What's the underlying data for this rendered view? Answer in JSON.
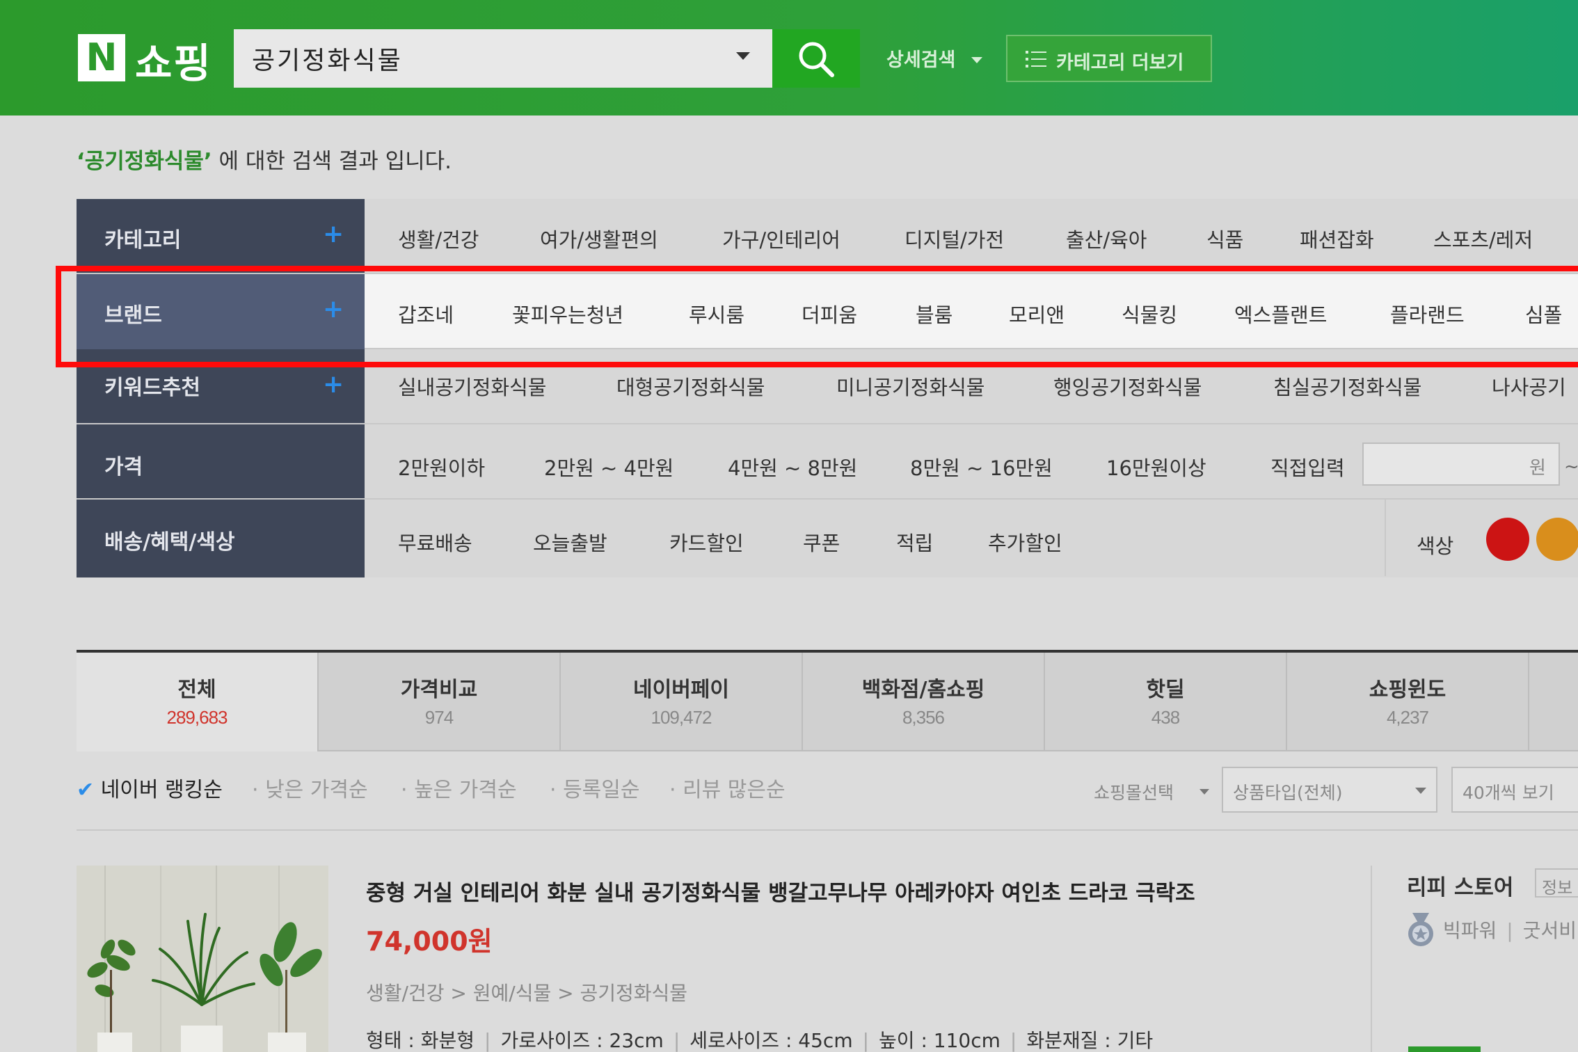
{
  "header": {
    "logo_letter": "N",
    "logo_text": "쇼핑",
    "search_value": "공기정화식물",
    "advanced_search": "상세검색",
    "category_more": "카테고리 더보기"
  },
  "result_line": {
    "keyword": "‘공기정화식물’",
    "suffix": " 에 대한 검색 결과 입니다."
  },
  "filters": {
    "category": {
      "label": "카테고리",
      "plus": "+",
      "items": [
        "생활/건강",
        "여가/생활편의",
        "가구/인테리어",
        "디지털/가전",
        "출산/육아",
        "식품",
        "패션잡화",
        "스포츠/레저"
      ]
    },
    "brand": {
      "label": "브랜드",
      "plus": "+",
      "items": [
        "갑조네",
        "꽃피우는청년",
        "루시룸",
        "더피움",
        "블룸",
        "모리앤",
        "식물킹",
        "엑스플랜트",
        "플라랜드",
        "심폴"
      ]
    },
    "keyword": {
      "label": "키워드추천",
      "plus": "+",
      "items": [
        "실내공기정화식물",
        "대형공기정화식물",
        "미니공기정화식물",
        "행잉공기정화식물",
        "침실공기정화식물",
        "나사공기"
      ]
    },
    "price": {
      "label": "가격",
      "items": [
        "2만원이하",
        "2만원 ~ 4만원",
        "4만원 ~ 8만원",
        "8만원 ~ 16만원",
        "16만원이상",
        "직접입력"
      ],
      "unit": "원",
      "tilde": "~"
    },
    "delivery": {
      "label": "배송/혜택/색상",
      "items": [
        "무료배송",
        "오늘출발",
        "카드할인",
        "쿠폰",
        "적립",
        "추가할인"
      ],
      "color_label": "색상",
      "swatches": [
        "#cc1414",
        "#d98e1c"
      ]
    }
  },
  "tabs": [
    {
      "name": "전체",
      "count": "289,683"
    },
    {
      "name": "가격비교",
      "count": "974"
    },
    {
      "name": "네이버페이",
      "count": "109,472"
    },
    {
      "name": "백화점/홈쇼핑",
      "count": "8,356"
    },
    {
      "name": "핫딜",
      "count": "438"
    },
    {
      "name": "쇼핑윈도",
      "count": "4,237"
    }
  ],
  "sort": {
    "check": "✔",
    "items": [
      "네이버 랭킹순",
      "· 낮은 가격순",
      "· 높은 가격순",
      "· 등록일순",
      "· 리뷰 많은순"
    ],
    "mall_select": "쇼핑몰선택",
    "type_select": "상품타입(전체)",
    "count_select": "40개씩 보기"
  },
  "product": {
    "title": "중형 거실 인테리어 화분 실내 공기정화식물 뱅갈고무나무 아레카야자 여인초 드라코 극락조",
    "price": "74,000원",
    "category_path": "생활/건강 > 원예/식물 > 공기정화식물",
    "specs": [
      "형태 : 화분형",
      "가로사이즈 : 23cm",
      "세로사이즈 : 45cm",
      "높이 : 110cm",
      "화분재질 : 기타"
    ],
    "store_name": "리피 스토어",
    "store_info": "정보",
    "store_grade": "빅파워",
    "store_service": "굿서비",
    "store_sep": "|"
  },
  "colors": {
    "header_green": "#2c9a2c",
    "sidebar": "#3e4658",
    "highlight": "#ff0a0a",
    "price_red": "#d0342c",
    "plus_blue": "#2b8ce8"
  }
}
